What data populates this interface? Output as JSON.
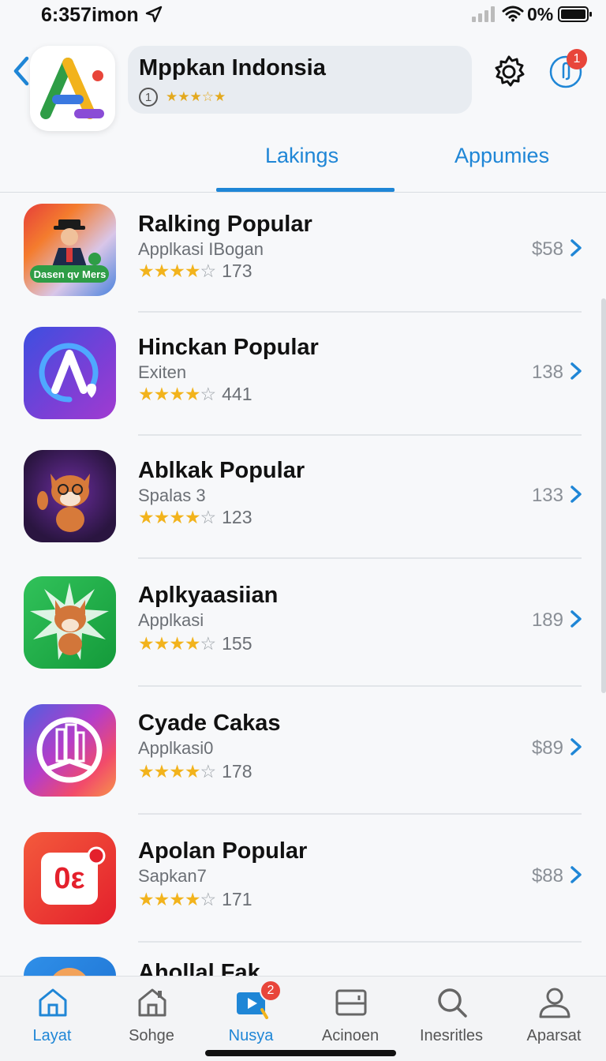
{
  "status_bar": {
    "time": "6:357imon",
    "battery": "0%"
  },
  "header": {
    "title": "Mppkan Indonsia",
    "circle_number": "1",
    "stars": "★★★☆★",
    "notification_count": "1"
  },
  "tabs": [
    {
      "label": "Lakings",
      "active": true
    },
    {
      "label": "Appumies",
      "active": false
    }
  ],
  "apps": [
    {
      "title": "Ralking Popular",
      "subtitle": "Applkasi IBogan",
      "rating": 4,
      "rating_count": "173",
      "price": "$58",
      "icon": "game-character-icon",
      "icon_text": "Dasen qv Mers"
    },
    {
      "title": "Hinckan Popular",
      "subtitle": "Exiten",
      "rating": 4,
      "rating_count": "441",
      "price": "138",
      "icon": "letter-a-heart-icon"
    },
    {
      "title": "Ablkak Popular",
      "subtitle": "Spalas 3",
      "rating": 4,
      "rating_count": "123",
      "price": "133",
      "icon": "fox-waving-icon"
    },
    {
      "title": "Aplkyaasiian",
      "subtitle": "Applkasi",
      "rating": 4,
      "rating_count": "155",
      "price": "189",
      "icon": "fox-green-icon"
    },
    {
      "title": "Cyade Cakas",
      "subtitle": "Applkasi0",
      "rating": 4,
      "rating_count": "178",
      "price": "$89",
      "icon": "building-circle-icon"
    },
    {
      "title": "Apolan Popular",
      "subtitle": "Sapkan7",
      "rating": 4,
      "rating_count": "171",
      "price": "$88",
      "icon": "calendar-badge-icon",
      "icon_text": "0ε"
    },
    {
      "title": "Ahollal Fak",
      "subtitle": "",
      "rating": 0,
      "rating_count": "",
      "price": "",
      "icon": "partial-app-icon"
    }
  ],
  "bottom_nav": [
    {
      "label": "Layat",
      "icon": "home-icon",
      "active": true
    },
    {
      "label": "Sohge",
      "icon": "house-outline-icon",
      "active": false
    },
    {
      "label": "Nusya",
      "icon": "play-video-icon",
      "active": false,
      "badge": "2"
    },
    {
      "label": "Acinoen",
      "icon": "tablet-icon",
      "active": false
    },
    {
      "label": "Inesritles",
      "icon": "search-icon",
      "active": false
    },
    {
      "label": "Aparsat",
      "icon": "profile-icon",
      "active": false
    }
  ],
  "colors": {
    "accent": "#1f86d6",
    "star": "#f2b31c",
    "badge": "#e8453a"
  }
}
